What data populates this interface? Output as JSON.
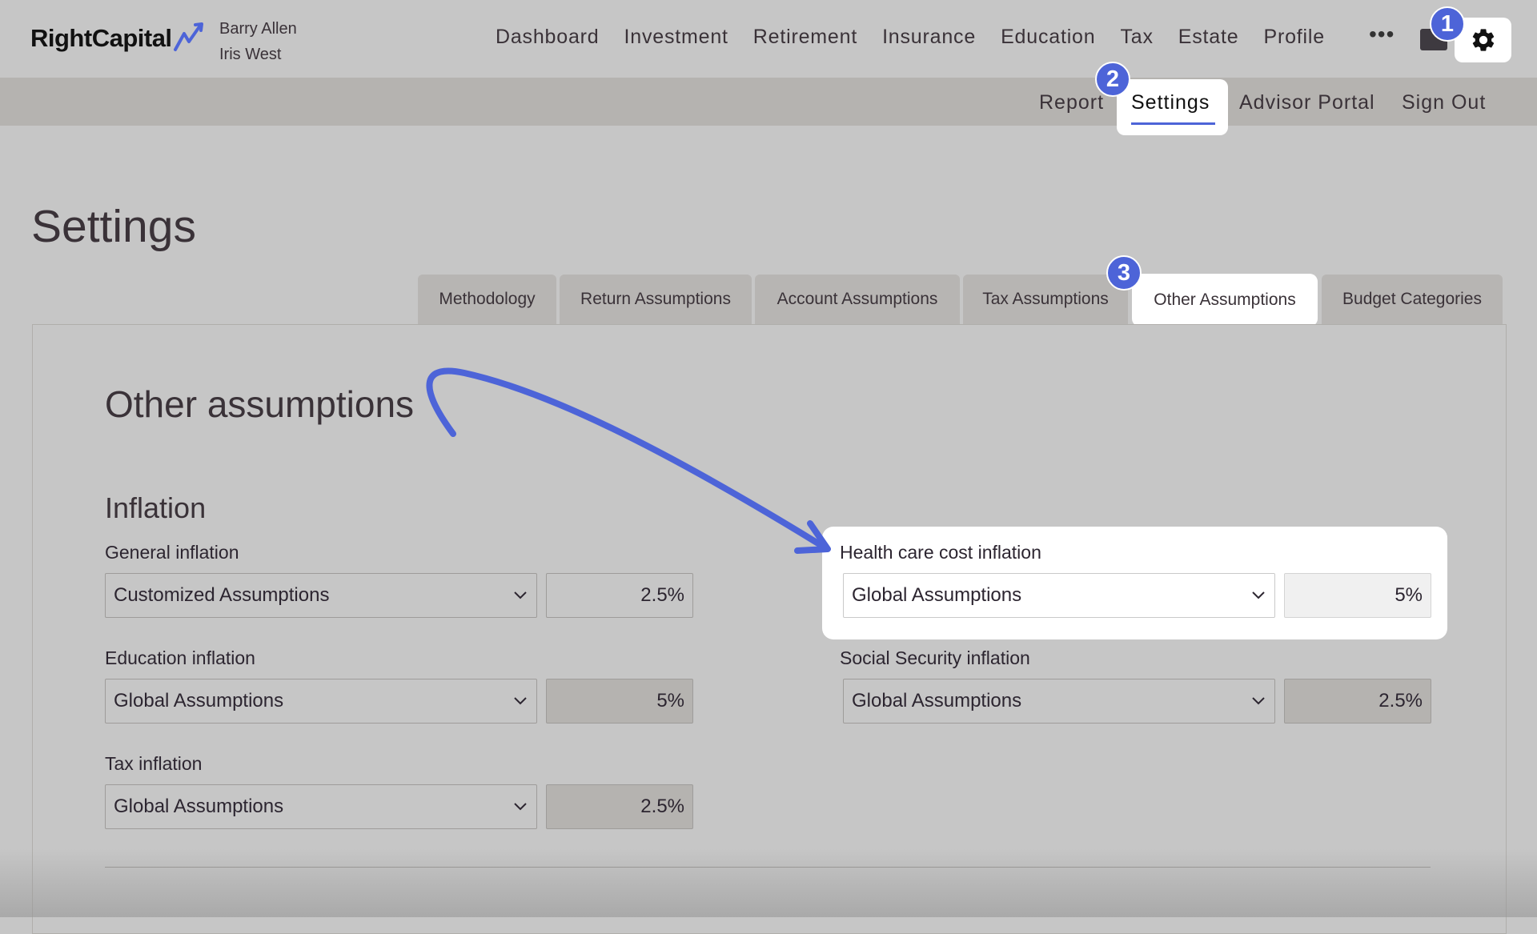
{
  "app": {
    "logo_text": "RightCapital"
  },
  "clients": [
    "Barry Allen",
    "Iris West"
  ],
  "main_nav": [
    "Dashboard",
    "Investment",
    "Retirement",
    "Insurance",
    "Education",
    "Tax",
    "Estate",
    "Profile"
  ],
  "more_label": "•••",
  "sub_nav": {
    "report": "Report",
    "settings": "Settings",
    "advisor_portal": "Advisor Portal",
    "sign_out": "Sign Out"
  },
  "badges": [
    "1",
    "2",
    "3"
  ],
  "page_title": "Settings",
  "tabs": [
    "Methodology",
    "Return Assumptions",
    "Account Assumptions",
    "Tax Assumptions",
    "Other Assumptions",
    "Budget Categories"
  ],
  "active_tab": "Other Assumptions",
  "section_title": "Other assumptions",
  "inflation": {
    "title": "Inflation",
    "general": {
      "label": "General inflation",
      "source": "Customized Assumptions",
      "value": "2.5%"
    },
    "health_care": {
      "label": "Health care cost inflation",
      "source": "Global Assumptions",
      "value": "5%"
    },
    "education": {
      "label": "Education inflation",
      "source": "Global Assumptions",
      "value": "5%"
    },
    "social_security": {
      "label": "Social Security inflation",
      "source": "Global Assumptions",
      "value": "2.5%"
    },
    "tax": {
      "label": "Tax inflation",
      "source": "Global Assumptions",
      "value": "2.5%"
    }
  },
  "colors": {
    "accent": "#4d64d8",
    "background": "#c6c6c6",
    "subbar": "#b5b3b0",
    "highlight": "#ffffff"
  },
  "icons": [
    "logo-arrow-icon",
    "folder-icon",
    "gear-icon",
    "chevron-down-icon",
    "annotation-arrow"
  ]
}
